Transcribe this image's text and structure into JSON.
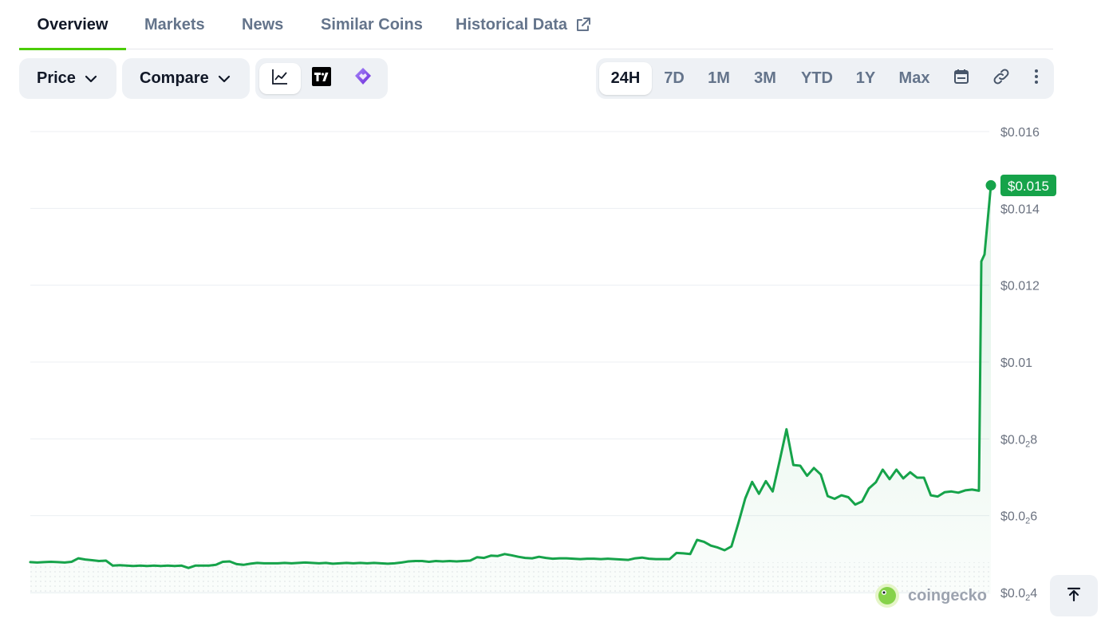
{
  "tabs": [
    {
      "label": "Overview",
      "active": true
    },
    {
      "label": "Markets"
    },
    {
      "label": "News"
    },
    {
      "label": "Similar Coins"
    },
    {
      "label": "Historical Data",
      "icon": "external-link-icon"
    }
  ],
  "toolbar": {
    "price_label": "Price",
    "compare_label": "Compare",
    "chart_types": [
      {
        "icon": "line-chart-icon",
        "active": true
      },
      {
        "icon": "tradingview-icon"
      },
      {
        "icon": "diamond-icon"
      }
    ],
    "ranges": [
      "24H",
      "7D",
      "1M",
      "3M",
      "YTD",
      "1Y",
      "Max"
    ],
    "active_range": "24H",
    "extra_icons": [
      "calendar-icon",
      "link-icon",
      "more-vertical-icon"
    ]
  },
  "colors": {
    "accent_tab": "#4bcc00",
    "line": "#16a34a",
    "badge": "#16a34a",
    "fill": "#dcfce7"
  },
  "chart_data": {
    "type": "area",
    "y_tick_labels": [
      {
        "value": 0.016,
        "label": "$0.016"
      },
      {
        "value": 0.014,
        "label": "$0.014"
      },
      {
        "value": 0.012,
        "label": "$0.012"
      },
      {
        "value": 0.01,
        "label": "$0.01"
      },
      {
        "value": 0.008,
        "label": "$0.0",
        "sub": "2",
        "tail": "8"
      },
      {
        "value": 0.006,
        "label": "$0.0",
        "sub": "2",
        "tail": "6"
      },
      {
        "value": 0.004,
        "label": "$0.0",
        "sub": "2",
        "tail": "4"
      }
    ],
    "ylim": [
      0.004,
      0.016
    ],
    "grid": true,
    "current_price_label": "$0.015",
    "current_price": 0.0146,
    "series": [
      {
        "values": [
          0.00479,
          0.00478,
          0.00479,
          0.0048,
          0.00479,
          0.00478,
          0.0048,
          0.00489,
          0.00486,
          0.00484,
          0.00482,
          0.00483,
          0.0047,
          0.00471,
          0.0047,
          0.00469,
          0.0047,
          0.00469,
          0.0047,
          0.00469,
          0.0047,
          0.00469,
          0.0047,
          0.00464,
          0.0047,
          0.0047,
          0.0047,
          0.00472,
          0.0048,
          0.00481,
          0.00474,
          0.00472,
          0.00475,
          0.00477,
          0.00476,
          0.00476,
          0.00476,
          0.00477,
          0.00476,
          0.00477,
          0.00478,
          0.00477,
          0.00476,
          0.00477,
          0.00475,
          0.00476,
          0.00477,
          0.00476,
          0.00477,
          0.00476,
          0.00477,
          0.00476,
          0.00475,
          0.00476,
          0.00478,
          0.00481,
          0.00482,
          0.00482,
          0.0048,
          0.00482,
          0.00481,
          0.00482,
          0.00481,
          0.00482,
          0.00483,
          0.00492,
          0.0049,
          0.00496,
          0.00495,
          0.005,
          0.00497,
          0.00493,
          0.0049,
          0.00489,
          0.00493,
          0.0049,
          0.00488,
          0.00489,
          0.00489,
          0.00488,
          0.00487,
          0.00488,
          0.00488,
          0.00487,
          0.00488,
          0.00487,
          0.00486,
          0.00485,
          0.00489,
          0.00491,
          0.00488,
          0.00487,
          0.00487,
          0.00487,
          0.00503,
          0.00502,
          0.005,
          0.00537,
          0.00532,
          0.00522,
          0.00517,
          0.0051,
          0.0052,
          0.0058,
          0.00645,
          0.00688,
          0.00657,
          0.0069,
          0.00663,
          0.00742,
          0.00825,
          0.00732,
          0.0073,
          0.00704,
          0.00724,
          0.00707,
          0.00651,
          0.00644,
          0.00653,
          0.00648,
          0.00629,
          0.00637,
          0.00671,
          0.00687,
          0.0072,
          0.00695,
          0.0072,
          0.00697,
          0.00713,
          0.00699,
          0.00699,
          0.00653,
          0.0065,
          0.00661,
          0.00663,
          0.0066,
          0.00666,
          0.00668,
          0.00665,
          0.01262,
          0.0128,
          0.0146
        ]
      }
    ]
  },
  "brand": {
    "name": "coingecko",
    "icon": "gecko-logo-icon"
  },
  "scroll_top": {
    "icon": "arrow-up-to-top-icon"
  }
}
